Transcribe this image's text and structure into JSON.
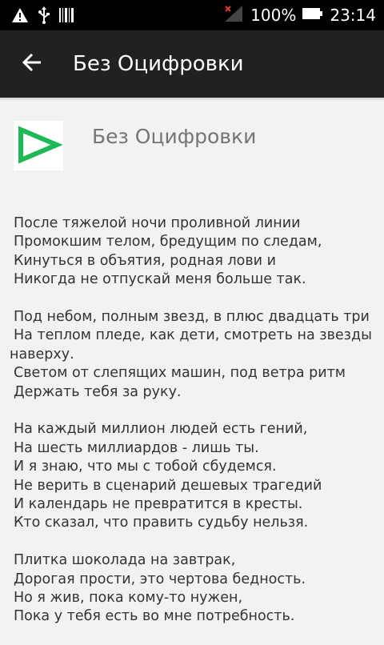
{
  "status_bar": {
    "battery_percent": "100%",
    "time": "23:14",
    "icons": [
      "warning-icon",
      "usb-icon",
      "barcode-icon",
      "signal-icon",
      "battery-icon"
    ]
  },
  "app_bar": {
    "title": "Без Оцифровки",
    "back_icon": "arrow-left-icon"
  },
  "song": {
    "title": "Без Оцифровки",
    "logo_icon": "play-icon",
    "logo_color": "#1db954",
    "stanzas": [
      {
        "lines": [
          "После тяжелой ночи проливной линии",
          "Промокшим телом, бредущим по следам,",
          "Кинуться в объятия, родная лови и",
          "Никогда не отпускай меня больше так."
        ]
      },
      {
        "lines": [
          "Под небом, полным звезд, в плюс двадцать три",
          "На теплом пледе, как дети, смотреть на звезды наверху.",
          "Светом от слепящих машин, под ветра ритм",
          "Держать тебя за руку."
        ]
      },
      {
        "lines": [
          "На каждый миллион людей есть гений,",
          "На шесть миллиардов - лишь ты.",
          "И я знаю, что мы с тобой сбудемся.",
          "Не верить в сценарий дешевых трагедий",
          "И календарь не превратится в кресты.",
          "Кто сказал, что править судьбу нельзя."
        ]
      },
      {
        "lines": [
          "Плитка шоколада на завтрак,",
          "Дорогая прости, это чертова бедность.",
          "Но я жив, пока кому-то нужен,",
          "Пока у тебя есть во мне потребность."
        ]
      }
    ]
  }
}
